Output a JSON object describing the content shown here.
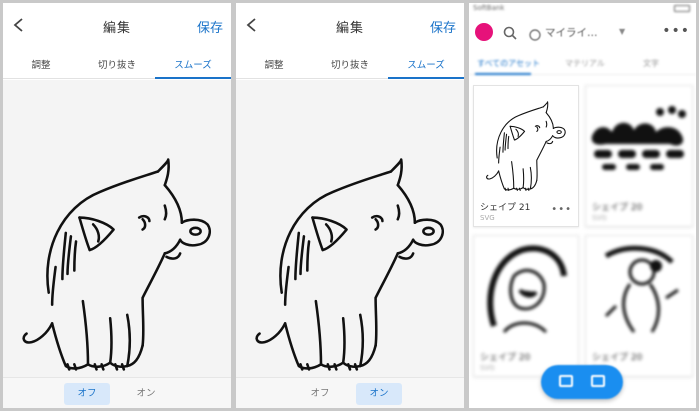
{
  "editor": {
    "title": "編集",
    "save_label": "保存",
    "tabs": [
      "調整",
      "切り抜き",
      "スムーズ"
    ],
    "active_tab": "スムーズ",
    "toggle_off": "オフ",
    "toggle_on": "オン"
  },
  "panels": [
    {
      "active_toggle": "オフ"
    },
    {
      "active_toggle": "オン"
    }
  ],
  "library": {
    "status_carrier": "SoftBank",
    "title": "マイライ…",
    "tabs": [
      "すべてのアセット",
      "マテリアル",
      "文字"
    ],
    "active_tab": "すべてのアセット",
    "cards": [
      {
        "name": "シェイプ 21",
        "type": "SVG"
      },
      {
        "name": "シェイプ 20",
        "type": "SVG"
      },
      {
        "name": "シェイプ 20",
        "type": "SVG"
      },
      {
        "name": "シェイプ 20",
        "type": "SVG"
      }
    ]
  },
  "colors": {
    "accent": "#1a73c9",
    "avatar": "#e6127a",
    "fab": "#1a8ef0"
  }
}
